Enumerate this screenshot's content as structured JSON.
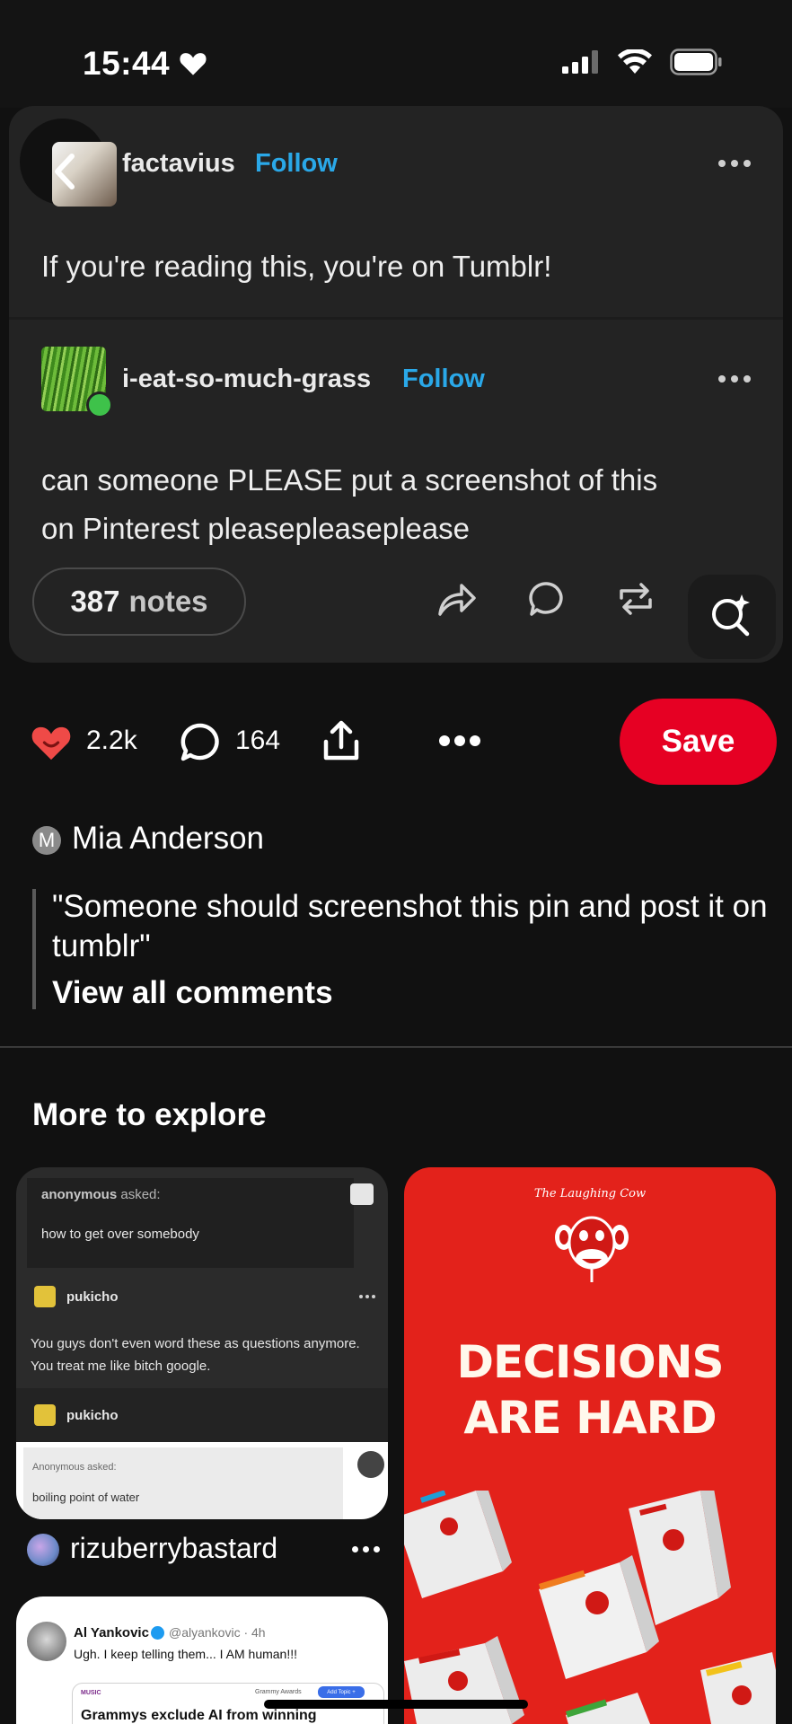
{
  "status_bar": {
    "time": "15:44"
  },
  "tumblr_post": {
    "op": {
      "blog": "factavius",
      "follow": "Follow",
      "text": "If you're reading this, you're on Tumblr!"
    },
    "reblog": {
      "blog": "i-eat-so-much-grass",
      "follow": "Follow",
      "text_line1": "can someone PLEASE put a screenshot of this",
      "text_line2": "on Pinterest pleasepleaseplease"
    },
    "notes_count": "387",
    "notes_label": "notes"
  },
  "pin_actions": {
    "likes": "2.2k",
    "comments": "164",
    "save_label": "Save"
  },
  "comment": {
    "avatar_letter": "M",
    "author": "Mia Anderson",
    "text": "\"Someone should screenshot this pin and post it on tumblr\"",
    "view_all": "View all comments"
  },
  "explore": {
    "title": "More to explore",
    "pins": [
      {
        "ask_author": "anonymous",
        "ask_suffix": "asked:",
        "ask_question": "how to get over somebody",
        "answerer": "pukicho",
        "answer": "You guys don't even word these as questions anymore. You treat me like bitch google.",
        "reblogger": "pukicho",
        "ask2_head": "Anonymous asked:",
        "ask2_question": "boiling point of water",
        "owner": "rizuberrybastard"
      },
      {
        "brand": "The Laughing Cow",
        "headline_line1": "DECISIONS",
        "headline_line2": "ARE HARD"
      },
      {
        "name": "Al Yankovic",
        "handle": "@alyankovic · 4h",
        "text": "Ugh. I keep telling them... I AM human!!!",
        "embed_section": "MUSIC",
        "embed_topic": "Grammy Awards",
        "embed_button": "Add Topic +",
        "embed_headline": "Grammys exclude AI from winning"
      }
    ]
  },
  "colors": {
    "accent": "#e60023",
    "tumblr_blue": "#2aa8e8",
    "cow_red": "#e3221b"
  }
}
